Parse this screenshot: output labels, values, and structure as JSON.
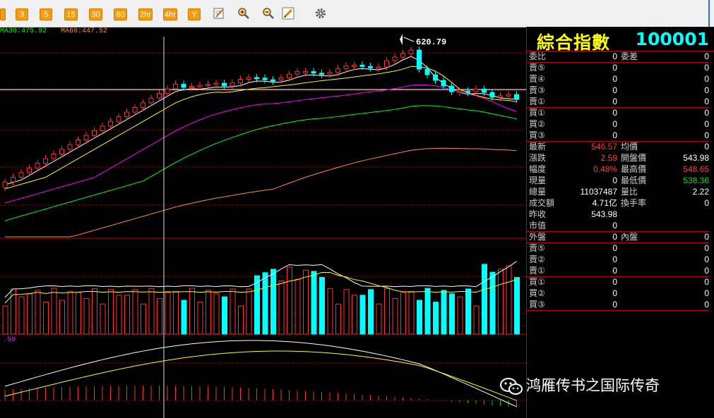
{
  "toolbar": {
    "buttons": [
      "3",
      "5",
      "15",
      "30",
      "60",
      "2hr",
      "4hr",
      "Y"
    ],
    "icons": [
      "edit-icon",
      "zoom-in-icon",
      "zoom-out-icon",
      "draw-icon",
      "gear-icon"
    ]
  },
  "ma_legend": {
    "ma30": "MA30:475.92",
    "ma60": "MA60:447.52",
    "indicator_tick": ".50"
  },
  "chart": {
    "peak_label": "620.79",
    "colors": {
      "up": "#ff3030",
      "down": "#00ffff",
      "ma5": "#ffffff",
      "ma10": "#ffff00",
      "ma20": "#ff00ff",
      "ma30": "#00ff00",
      "ma60": "#ff8c3a",
      "grid": "#b00000"
    }
  },
  "panel": {
    "name": "綜合指數",
    "code": "100001",
    "weibi": {
      "label": "委比",
      "value": "0",
      "label2": "委差",
      "value2": "0"
    },
    "sell_rows": [
      {
        "label": "賣⑤",
        "value": "0",
        "value2": "0"
      },
      {
        "label": "賣④",
        "value": "0",
        "value2": "0"
      },
      {
        "label": "賣③",
        "value": "0",
        "value2": "0"
      },
      {
        "label": "賣①",
        "value": "0",
        "value2": "0"
      }
    ],
    "buy_rows": [
      {
        "label": "買①",
        "value": "0",
        "value2": "0"
      },
      {
        "label": "買②",
        "value": "0",
        "value2": "0"
      },
      {
        "label": "買③",
        "value": "0",
        "value2": "0"
      }
    ],
    "stats": [
      {
        "label": "最新",
        "value": "546.57",
        "vcolor": "red",
        "label2": "均價",
        "value2": "0",
        "v2color": ""
      },
      {
        "label": "漲跌",
        "value": "2.59",
        "vcolor": "red",
        "label2": "開盤價",
        "value2": "543.98",
        "v2color": ""
      },
      {
        "label": "幅度",
        "value": "0.48%",
        "vcolor": "red",
        "label2": "最高價",
        "value2": "548.65",
        "v2color": "red"
      },
      {
        "label": "現量",
        "value": "0",
        "vcolor": "",
        "label2": "最低價",
        "value2": "538.36",
        "v2color": "green"
      },
      {
        "label": "總量",
        "value": "11037487",
        "vcolor": "",
        "label2": "量比",
        "value2": "2.22",
        "v2color": ""
      },
      {
        "label": "成交額",
        "value": "4.71亿",
        "vcolor": "",
        "label2": "換手率",
        "value2": "0",
        "v2color": ""
      },
      {
        "label": "昨收",
        "value": "543.98",
        "vcolor": "",
        "label2": "",
        "value2": "",
        "v2color": ""
      },
      {
        "label": "市值",
        "value": "0",
        "vcolor": "",
        "label2": "",
        "value2": "",
        "v2color": ""
      }
    ],
    "outer": {
      "label": "外盤",
      "value": "0",
      "label2": "內盤",
      "value2": "0"
    },
    "sell_rows2": [
      {
        "label": "賣⑤",
        "value": "0",
        "value2": "0"
      },
      {
        "label": "賣②",
        "value": "0",
        "value2": "0"
      },
      {
        "label": "賣①",
        "value": "0",
        "value2": "0"
      }
    ],
    "buy_rows2": [
      {
        "label": "買①",
        "value": "0",
        "value2": "0"
      },
      {
        "label": "買②",
        "value": "0",
        "value2": "0"
      },
      {
        "label": "買③",
        "value": "0",
        "value2": "0"
      }
    ]
  },
  "watermark": {
    "text": "鸿雁传书之国际传奇"
  }
}
